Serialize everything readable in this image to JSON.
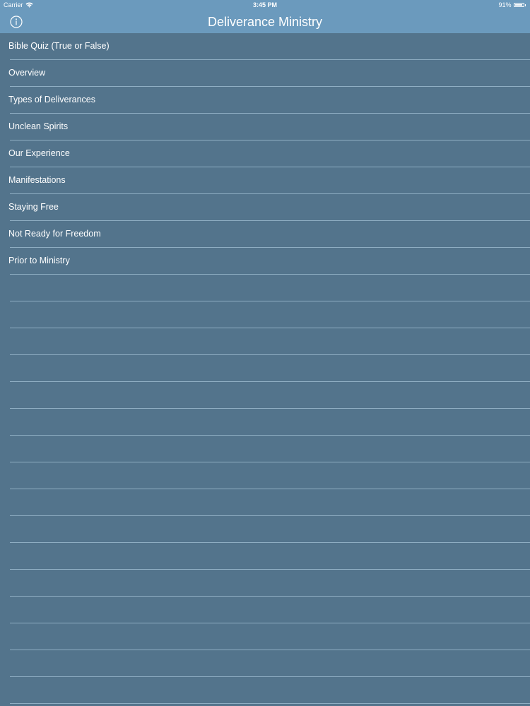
{
  "status_bar": {
    "carrier": "Carrier",
    "wifi_icon": "wifi-icon",
    "time": "3:45 PM",
    "battery_percent": "91%",
    "battery_level": 0.91
  },
  "nav": {
    "title": "Deliverance Ministry",
    "info_icon": "info-icon"
  },
  "colors": {
    "nav_background": "#6b9abd",
    "list_background": "#53748c",
    "separator": "#8faec3",
    "text": "#ffffff"
  },
  "menu": {
    "items": [
      {
        "label": "Bible Quiz (True or False)"
      },
      {
        "label": "Overview"
      },
      {
        "label": "Types of Deliverances"
      },
      {
        "label": "Unclean Spirits"
      },
      {
        "label": "Our Experience"
      },
      {
        "label": "Manifestations"
      },
      {
        "label": "Staying Free"
      },
      {
        "label": "Not Ready for Freedom"
      },
      {
        "label": "Prior to Ministry"
      }
    ]
  }
}
